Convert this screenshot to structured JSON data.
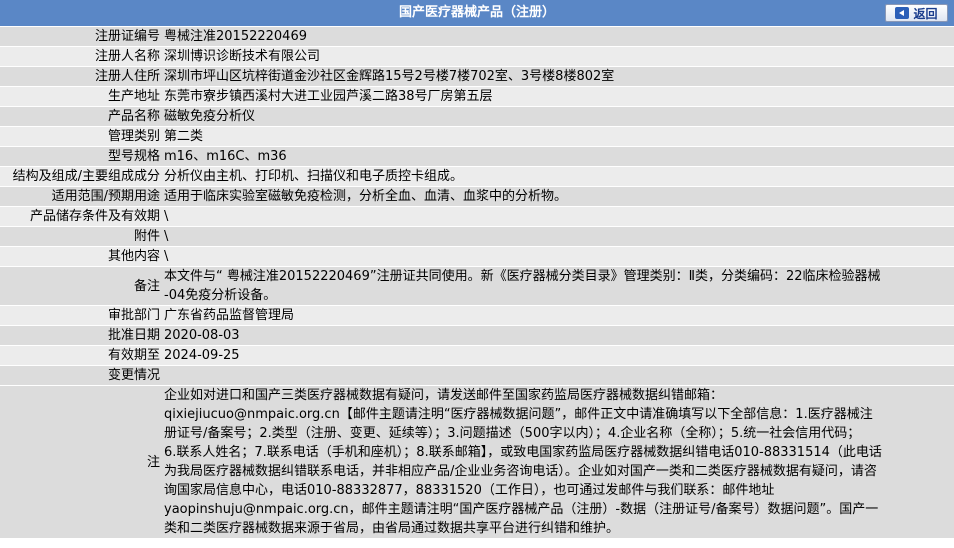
{
  "header": {
    "title": "国产医疗器械产品（注册）",
    "back_label": "返回",
    "back_icon": "back-arrow-icon",
    "colors": {
      "bar": "#5a87c6",
      "row_dark": "#dcdcdc",
      "row_light": "#ececec"
    }
  },
  "rows": [
    {
      "label": "注册证编号",
      "value": "粤械注准20152220469"
    },
    {
      "label": "注册人名称",
      "value": "深圳博识诊断技术有限公司"
    },
    {
      "label": "注册人住所",
      "value": "深圳市坪山区坑梓街道金沙社区金辉路15号2号楼7楼702室、3号楼8楼802室"
    },
    {
      "label": "生产地址",
      "value": "东莞市寮步镇西溪村大进工业园芦溪二路38号厂房第五层"
    },
    {
      "label": "产品名称",
      "value": "磁敏免疫分析仪"
    },
    {
      "label": "管理类别",
      "value": "第二类"
    },
    {
      "label": "型号规格",
      "value": "m16、m16C、m36"
    },
    {
      "label": "结构及组成/主要组成成分",
      "value": "分析仪由主机、打印机、扫描仪和电子质控卡组成。"
    },
    {
      "label": "适用范围/预期用途",
      "value": "适用于临床实验室磁敏免疫检测，分析全血、血清、血浆中的分析物。"
    },
    {
      "label": "产品储存条件及有效期",
      "value": "\\"
    },
    {
      "label": "附件",
      "value": "\\"
    },
    {
      "label": "其他内容",
      "value": "\\"
    },
    {
      "label": "备注",
      "value_lines": [
        "本文件与“ 粤械注准20152220469”注册证共同使用。新《医疗器械分类目录》管理类别：Ⅱ类，分类编码：22临床检验器械",
        "-04免疫分析设备。"
      ]
    },
    {
      "label": "审批部门",
      "value": "广东省药品监督管理局"
    },
    {
      "label": "批准日期",
      "value": "2020-08-03"
    },
    {
      "label": "有效期至",
      "value": "2024-09-25"
    },
    {
      "label": "变更情况",
      "value": ""
    },
    {
      "label": "注",
      "value_lines": [
        "企业如对进口和国产三类医疗器械数据有疑问，请发送邮件至国家药监局医疗器械数据纠错邮箱：",
        "qixiejiucuo@nmpaic.org.cn【邮件主题请注明“医疗器械数据问题”，邮件正文中请准确填写以下全部信息：1.医疗器械注",
        "册证号/备案号；2.类型（注册、变更、延续等）；3.问题描述（500字以内）；4.企业名称（全称）；5.统一社会信用代码；",
        "6.联系人姓名；7.联系电话（手机和座机）；8.联系邮箱】，或致电国家药监局医疗器械数据纠错电话010-88331514（此电话",
        "为我局医疗器械数据纠错联系电话，并非相应产品/企业业务咨询电话）。企业如对国产一类和二类医疗器械数据有疑问，请咨",
        "询国家局信息中心，电话010-88332877，88331520（工作日），也可通过发邮件与我们联系：邮件地址",
        "yaopinshuju@nmpaic.org.cn，邮件主题请注明“国产医疗器械产品（注册）-数据（注册证号/备案号）数据问题”。国产一",
        "类和二类医疗器械数据来源于省局，由省局通过数据共享平台进行纠错和维护。"
      ]
    }
  ]
}
